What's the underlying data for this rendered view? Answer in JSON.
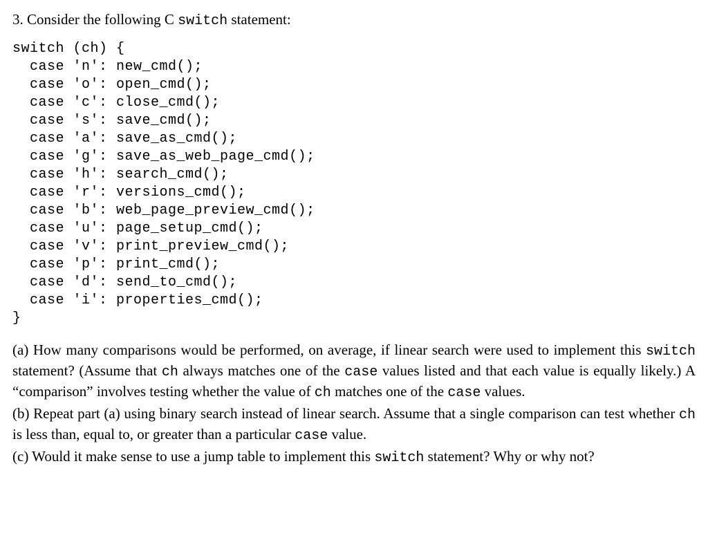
{
  "intro": {
    "number": "3.",
    "lead_text": " Consider the following C ",
    "code_word": "switch",
    "tail_text": " statement:"
  },
  "code": {
    "head": "switch (ch) {",
    "cases": [
      {
        "ch": "n",
        "fn": "new_cmd"
      },
      {
        "ch": "o",
        "fn": "open_cmd"
      },
      {
        "ch": "c",
        "fn": "close_cmd"
      },
      {
        "ch": "s",
        "fn": "save_cmd"
      },
      {
        "ch": "a",
        "fn": "save_as_cmd"
      },
      {
        "ch": "g",
        "fn": "save_as_web_page_cmd"
      },
      {
        "ch": "h",
        "fn": "search_cmd"
      },
      {
        "ch": "r",
        "fn": "versions_cmd"
      },
      {
        "ch": "b",
        "fn": "web_page_preview_cmd"
      },
      {
        "ch": "u",
        "fn": "page_setup_cmd"
      },
      {
        "ch": "v",
        "fn": "print_preview_cmd"
      },
      {
        "ch": "p",
        "fn": "print_cmd"
      },
      {
        "ch": "d",
        "fn": "send_to_cmd"
      },
      {
        "ch": "i",
        "fn": "properties_cmd"
      }
    ],
    "foot": "}"
  },
  "q": {
    "a": {
      "t1": "(a) How many comparisons would be performed, on average, if linear search were used to implement this ",
      "c1": "switch",
      "t2": " statement? (Assume that ",
      "c2": "ch",
      "t3": " always matches one of the ",
      "c3": "case",
      "t4": " values listed and that each value is equally likely.) A “comparison” involves testing whether the value of ",
      "c4": "ch",
      "t5": " matches one of the ",
      "c5": "case",
      "t6": " values."
    },
    "b": {
      "t1": "(b) Repeat part (a) using binary search instead of linear search. Assume that a single comparison can test whether ",
      "c1": "ch",
      "t2": " is less than, equal to, or greater than a particular ",
      "c2": "case",
      "t3": " value."
    },
    "c": {
      "t1": "(c) Would it make sense to use a jump table to implement this ",
      "c1": "switch",
      "t2": " statement? Why or why not?"
    }
  }
}
